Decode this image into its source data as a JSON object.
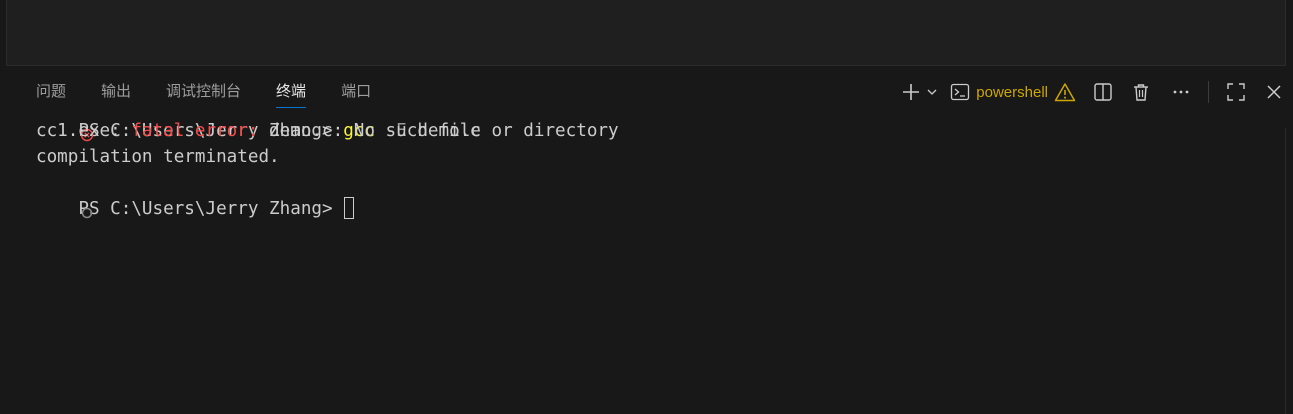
{
  "panel": {
    "tabs": [
      {
        "label": "问题",
        "active": false
      },
      {
        "label": "输出",
        "active": false
      },
      {
        "label": "调试控制台",
        "active": false
      },
      {
        "label": "终端",
        "active": true
      },
      {
        "label": "端口",
        "active": false
      }
    ],
    "actions": {
      "new_terminal_icon": "plus-icon",
      "dropdown_icon": "chevron-down-icon",
      "shell_icon": "terminal-icon",
      "shell_name": "powershell",
      "warning_icon": "warning-icon",
      "split_icon": "split-editor-icon",
      "kill_icon": "trash-icon",
      "more_icon": "ellipsis-icon",
      "maximize_icon": "maximize-icon",
      "close_icon": "close-icon"
    }
  },
  "terminal": {
    "lines": [
      {
        "decoration": "error",
        "prompt": "PS C:\\Users\\Jerry Zhang> ",
        "command": "gcc",
        "flag": "-E",
        "args": "demo.c"
      },
      {
        "prefix": "cc1.exe: ",
        "error": "fatal error:",
        "rest": " demo.c: No such file or directory"
      },
      {
        "text": "compilation terminated."
      },
      {
        "decoration": "idle",
        "prompt": "PS C:\\Users\\Jerry Zhang> "
      }
    ]
  },
  "colors": {
    "background": "#181818",
    "accent": "#0078d4",
    "error": "#f14c4c",
    "command": "#f5f543",
    "warning": "#cca700"
  }
}
